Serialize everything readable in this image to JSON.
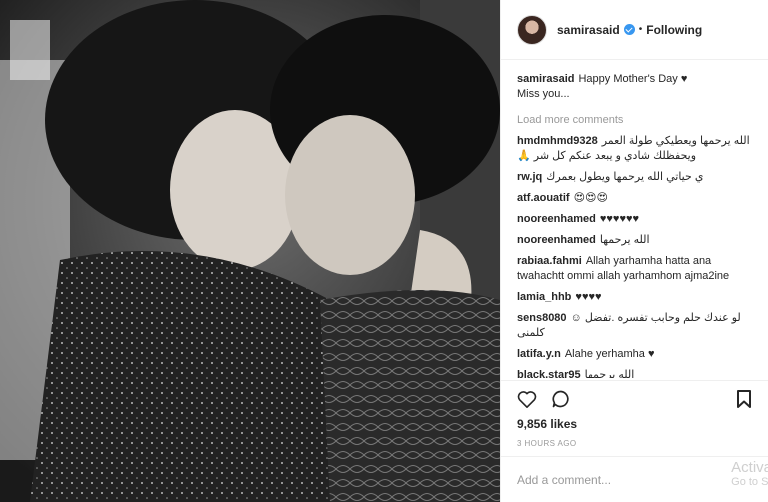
{
  "post": {
    "username": "samirasaid",
    "follow_status": "Following",
    "separator": "•",
    "caption_text": "Happy Mother's Day ♥",
    "caption_line2": "Miss you...",
    "load_more": "Load more comments",
    "likes": "9,856 likes",
    "time": "3 HOURS AGO",
    "add_comment_placeholder": "Add a comment...",
    "watermark_line1": "Activa",
    "watermark_line2": "Go to S"
  },
  "comments": [
    {
      "user": "hmdmhmd9328",
      "text": "الله يرحمها ويعطيكي طولة العمر ويحفظلك شادي و يبعد عنكم كل شر 🙏"
    },
    {
      "user": "rw.jq",
      "text": "ي حياتي الله يرحمها ويطول بعمرك"
    },
    {
      "user": "atf.aouatif",
      "text": "😍😍😍"
    },
    {
      "user": "nooreenhamed",
      "text": "♥♥♥♥♥♥"
    },
    {
      "user": "nooreenhamed",
      "text": "الله يرحمها"
    },
    {
      "user": "rabiaa.fahmi",
      "text": "Allah yarhamha hatta ana twahachtt ommi allah yarhamhom ajma2ine"
    },
    {
      "user": "lamia_hhb",
      "text": "♥♥♥♥"
    },
    {
      "user": "sens8080",
      "text": "لو عندك حلم وحابب تفسره .تفضل ☺ كلمنى"
    },
    {
      "user": "latifa.y.n",
      "text": "Alahe yerhamha ♥"
    },
    {
      "user": "black.star95",
      "text": "الله يرحمها"
    }
  ],
  "icons": {
    "heart": "heart-icon",
    "comment": "comment-icon",
    "bookmark": "bookmark-icon",
    "verified": "verified-badge-icon"
  },
  "colors": {
    "verified": "#3897f0",
    "muted": "#999999",
    "border": "#efefef"
  }
}
